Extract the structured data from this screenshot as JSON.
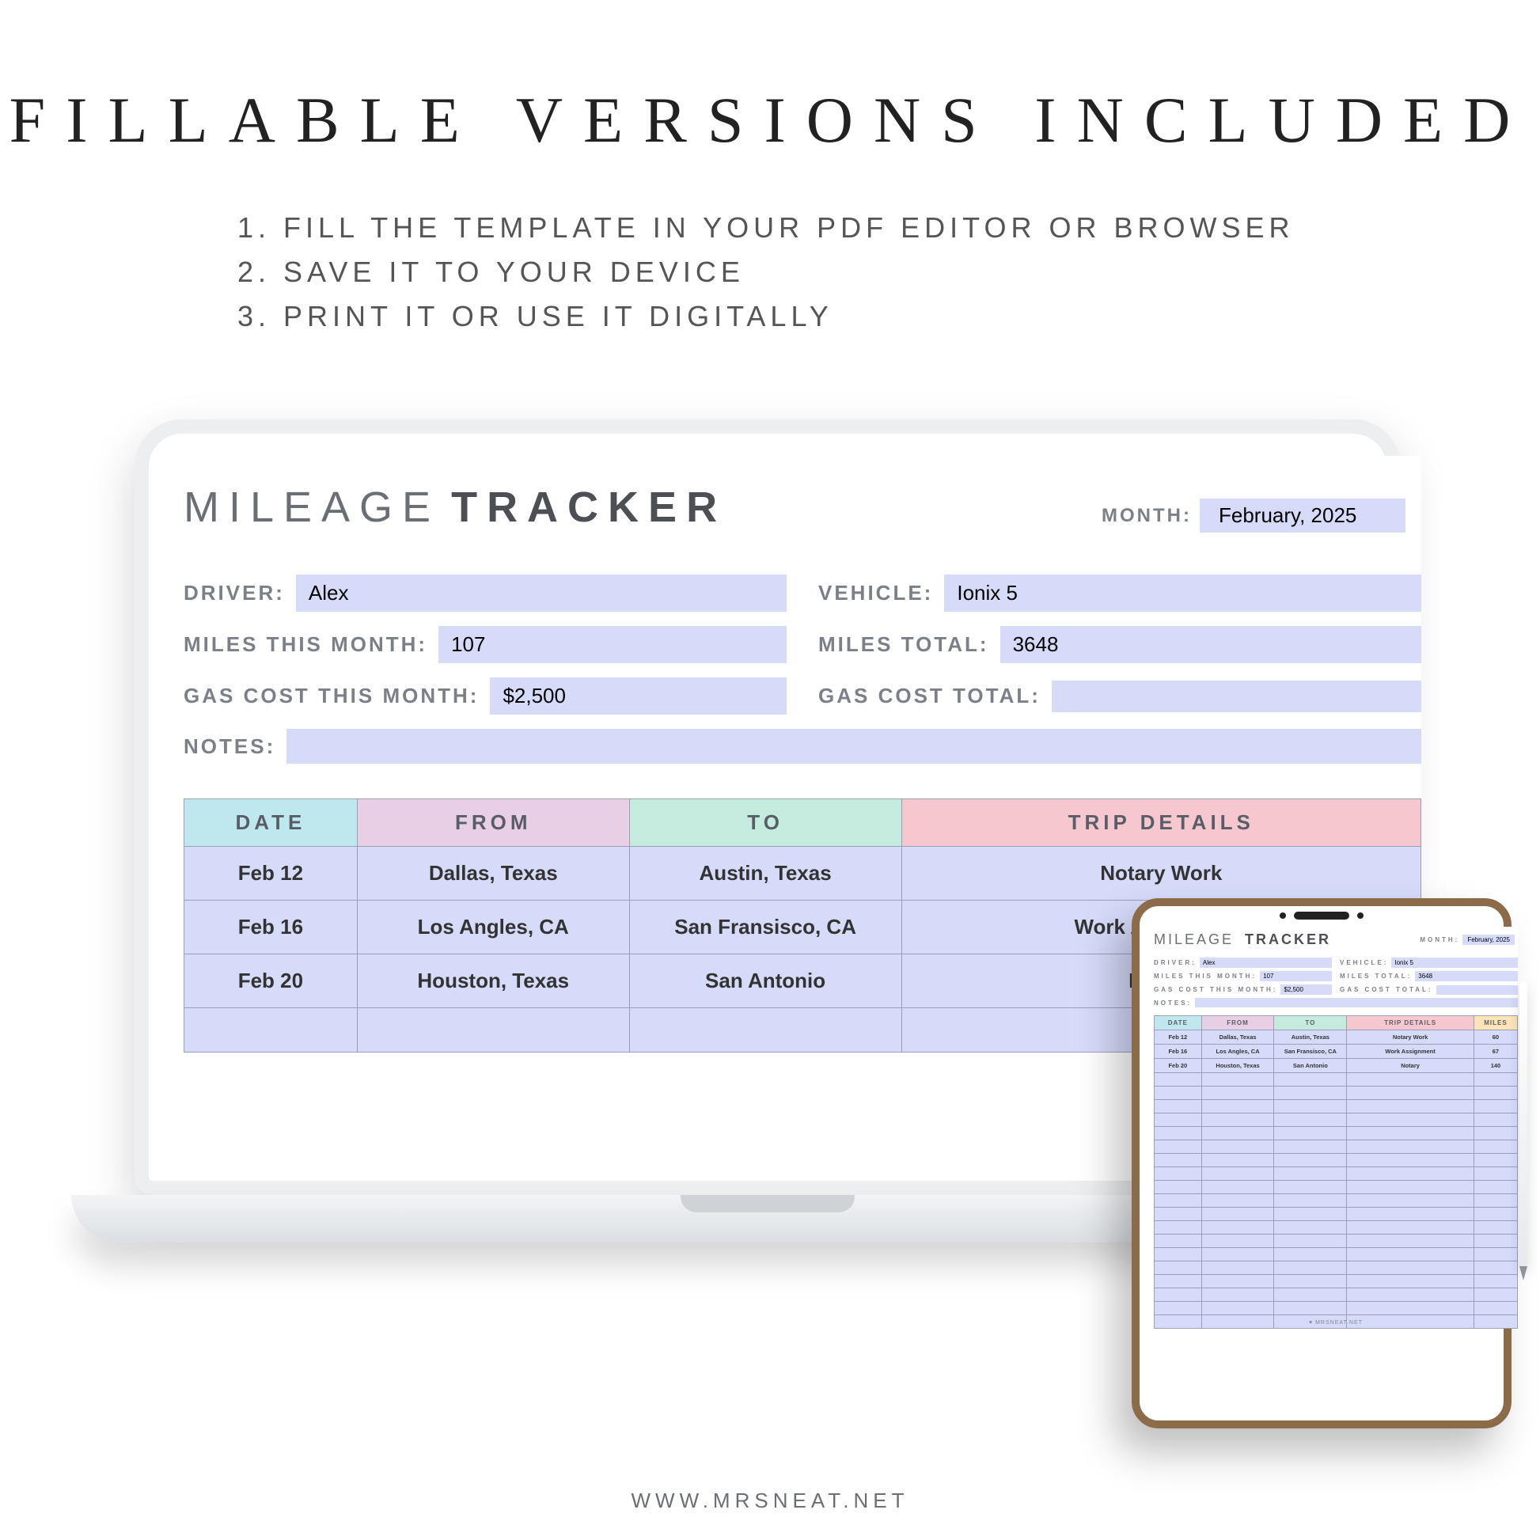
{
  "headline": "FILLABLE VERSIONS INCLUDED",
  "steps": [
    "1. FILL THE TEMPLATE IN YOUR PDF EDITOR OR BROWSER",
    "2. SAVE IT TO YOUR DEVICE",
    "3. PRINT IT OR USE IT DIGITALLY"
  ],
  "doc": {
    "title_thin": "MILEAGE",
    "title_bold": "TRACKER",
    "month_label": "MONTH:",
    "month_value": "February, 2025",
    "fields": {
      "driver_label": "DRIVER:",
      "driver_value": "Alex",
      "vehicle_label": "VEHICLE:",
      "vehicle_value": "Ionix 5",
      "miles_month_label": "MILES THIS MONTH:",
      "miles_month_value": "107",
      "miles_total_label": "MILES TOTAL:",
      "miles_total_value": "3648",
      "gas_month_label": "GAS COST THIS MONTH:",
      "gas_month_value": "$2,500",
      "gas_total_label": "GAS COST TOTAL:",
      "gas_total_value": "",
      "notes_label": "NOTES:",
      "notes_value": ""
    },
    "table": {
      "headers": {
        "date": "DATE",
        "from": "FROM",
        "to": "TO",
        "details": "TRIP DETAILS",
        "miles": "MILES"
      },
      "rows": [
        {
          "date": "Feb 12",
          "from": "Dallas, Texas",
          "to": "Austin, Texas",
          "details": "Notary Work",
          "miles": "60"
        },
        {
          "date": "Feb 16",
          "from": "Los Angles, CA",
          "to": "San Fransisco, CA",
          "details": "Work Assignment",
          "miles": "67"
        },
        {
          "date": "Feb 20",
          "from": "Houston, Texas",
          "to": "San Antonio",
          "details": "Notary",
          "miles": "140"
        }
      ]
    }
  },
  "tablet_footer": "♥ MRSNEAT.NET",
  "site": "WWW.MRSNEAT.NET",
  "colors": {
    "fill": "#d6dbfa",
    "th_date": "#bfe7ee",
    "th_from": "#e8cfe5",
    "th_to": "#c4ebdd",
    "th_details": "#f6c7cf",
    "th_miles": "#fde4b6"
  }
}
